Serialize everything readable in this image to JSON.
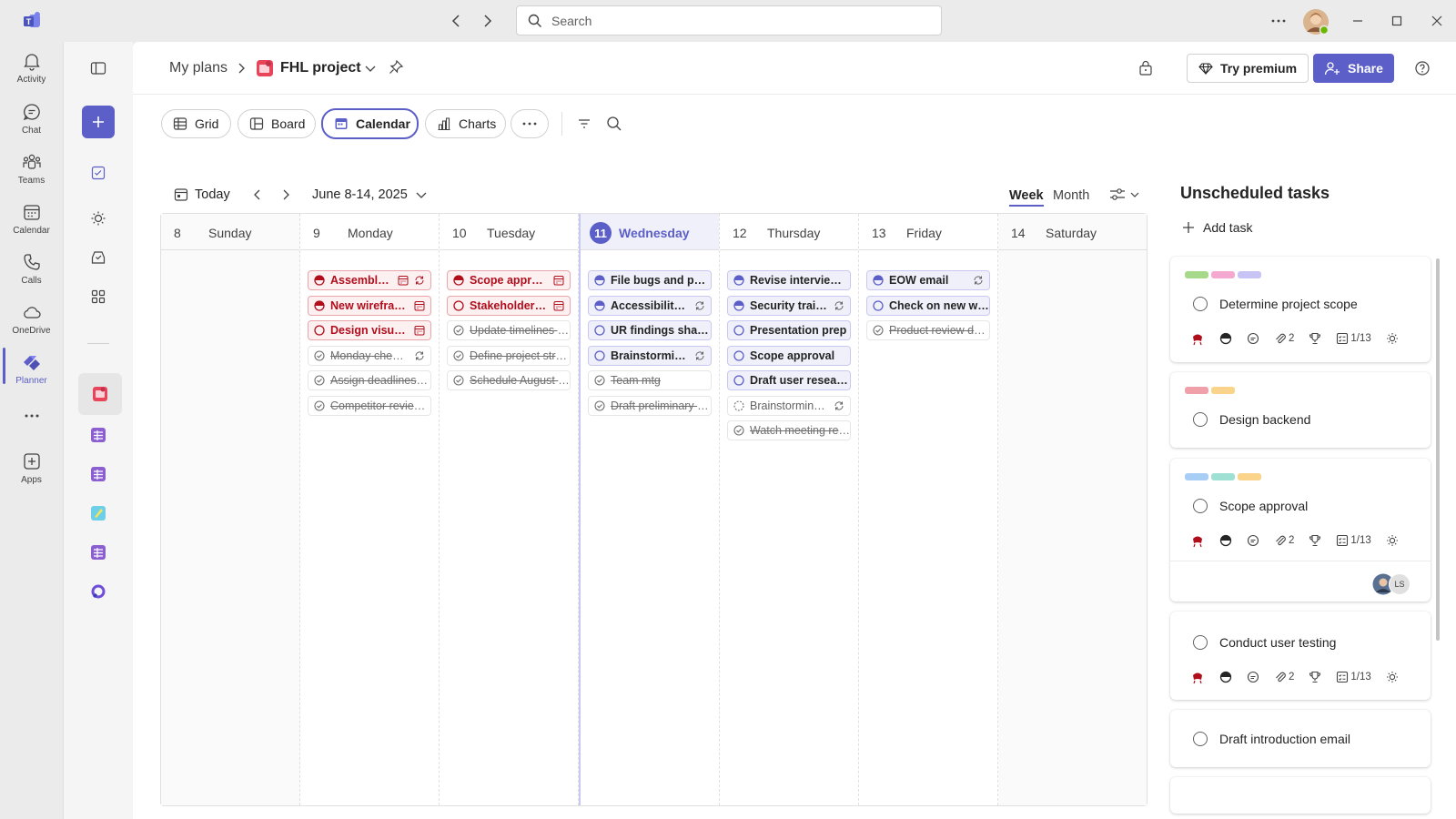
{
  "titlebar": {
    "search_placeholder": "Search"
  },
  "rail": {
    "items": [
      {
        "label": "Activity",
        "icon": "bell-icon"
      },
      {
        "label": "Chat",
        "icon": "chat-icon"
      },
      {
        "label": "Teams",
        "icon": "teams-icon"
      },
      {
        "label": "Calendar",
        "icon": "calendar-icon"
      },
      {
        "label": "Calls",
        "icon": "phone-icon"
      },
      {
        "label": "OneDrive",
        "icon": "cloud-icon"
      },
      {
        "label": "Planner",
        "icon": "planner-icon",
        "active": true
      },
      {
        "label": "Apps",
        "icon": "add-apps-icon"
      }
    ],
    "more": "..."
  },
  "header": {
    "crumb_root": "My plans",
    "plan_name": "FHL project",
    "try_premium": "Try premium",
    "share": "Share"
  },
  "views": {
    "grid": "Grid",
    "board": "Board",
    "calendar": "Calendar",
    "charts": "Charts",
    "active": "Calendar"
  },
  "calendar": {
    "today": "Today",
    "range": "June 8-14, 2025",
    "week": "Week",
    "month": "Month",
    "days": [
      {
        "num": "8",
        "name": "Sunday",
        "tasks": []
      },
      {
        "num": "9",
        "name": "Monday",
        "tasks": [
          {
            "title": "Assemble n...",
            "kind": "urg",
            "status": "half",
            "icons": [
              "calendar",
              "repeat"
            ]
          },
          {
            "title": "New wirefram...",
            "kind": "urg",
            "status": "half",
            "icons": [
              "calendar"
            ]
          },
          {
            "title": "Design visual c...",
            "kind": "urg",
            "status": "empty",
            "icons": [
              "calendar"
            ]
          },
          {
            "title": "Monday check-...",
            "kind": "done",
            "status": "check",
            "icons": [
              "repeat"
            ]
          },
          {
            "title": "Assign deadlines a...",
            "kind": "done",
            "status": "check",
            "icons": []
          },
          {
            "title": "Competitor review...",
            "kind": "done",
            "status": "check",
            "icons": []
          }
        ]
      },
      {
        "num": "10",
        "name": "Tuesday",
        "tasks": [
          {
            "title": "Scope approva...",
            "kind": "urg",
            "status": "half",
            "icons": [
              "calendar"
            ]
          },
          {
            "title": "Stakeholder ca...",
            "kind": "urg",
            "status": "empty",
            "icons": [
              "calendar"
            ]
          },
          {
            "title": "Update timelines f...",
            "kind": "done",
            "status": "check",
            "icons": []
          },
          {
            "title": "Define project stru...",
            "kind": "done",
            "status": "check",
            "icons": []
          },
          {
            "title": "Schedule August d...",
            "kind": "done",
            "status": "check",
            "icons": []
          }
        ]
      },
      {
        "num": "11",
        "name": "Wednesday",
        "today": true,
        "tasks": [
          {
            "title": "File bugs and poli...",
            "kind": "pur",
            "status": "half",
            "icons": []
          },
          {
            "title": "Accessibility tr...",
            "kind": "pur",
            "status": "half",
            "icons": [
              "repeat"
            ]
          },
          {
            "title": "UR findings share...",
            "kind": "pur",
            "status": "empty",
            "icons": []
          },
          {
            "title": "Brainstorming...",
            "kind": "pur",
            "status": "empty",
            "icons": [
              "repeat"
            ]
          },
          {
            "title": "Team mtg",
            "kind": "done",
            "status": "check",
            "icons": []
          },
          {
            "title": "Draft preliminary s...",
            "kind": "done",
            "status": "check",
            "icons": []
          }
        ]
      },
      {
        "num": "12",
        "name": "Thursday",
        "tasks": [
          {
            "title": "Revise interview s...",
            "kind": "pur",
            "status": "half",
            "icons": []
          },
          {
            "title": "Security training",
            "kind": "pur",
            "status": "half",
            "icons": [
              "repeat"
            ]
          },
          {
            "title": "Presentation prep",
            "kind": "pur",
            "status": "empty",
            "icons": []
          },
          {
            "title": "Scope approval",
            "kind": "pur",
            "status": "empty",
            "icons": []
          },
          {
            "title": "Draft user researc...",
            "kind": "pur",
            "status": "empty",
            "icons": []
          },
          {
            "title": "Brainstorming...",
            "kind": "plain",
            "status": "dotted",
            "icons": [
              "repeat"
            ]
          },
          {
            "title": "Watch meeting rec...",
            "kind": "done",
            "status": "check",
            "icons": []
          }
        ]
      },
      {
        "num": "13",
        "name": "Friday",
        "tasks": [
          {
            "title": "EOW email",
            "kind": "pur",
            "status": "half",
            "icons": [
              "repeat"
            ]
          },
          {
            "title": "Check on new wir...",
            "kind": "pur",
            "status": "empty",
            "icons": []
          },
          {
            "title": "Product review deck",
            "kind": "done",
            "status": "check",
            "icons": []
          }
        ]
      },
      {
        "num": "14",
        "name": "Saturday",
        "tasks": []
      }
    ]
  },
  "unscheduled": {
    "title": "Unscheduled tasks",
    "add_task": "Add task",
    "cards": [
      {
        "title": "Determine project scope",
        "labels": [
          "#a6d98a",
          "#f5a9d0",
          "#c7c3f5"
        ],
        "attachments": "2",
        "checklist": "1/13",
        "meta": true
      },
      {
        "title": "Design backend",
        "labels": [
          "#f0a0a8",
          "#f9d48a"
        ],
        "meta": false
      },
      {
        "title": "Scope approval",
        "labels": [
          "#a9cef5",
          "#9ee0d4",
          "#f9d48a"
        ],
        "attachments": "2",
        "checklist": "1/13",
        "meta": true,
        "assignees": [
          "LS"
        ]
      },
      {
        "title": "Conduct user testing",
        "labels": [],
        "attachments": "2",
        "checklist": "1/13",
        "meta": true
      },
      {
        "title": "Draft introduction email",
        "labels": [],
        "meta": false
      }
    ]
  },
  "colors": {
    "accent": "#5b5fc7",
    "urgent": "#b10e1c"
  }
}
